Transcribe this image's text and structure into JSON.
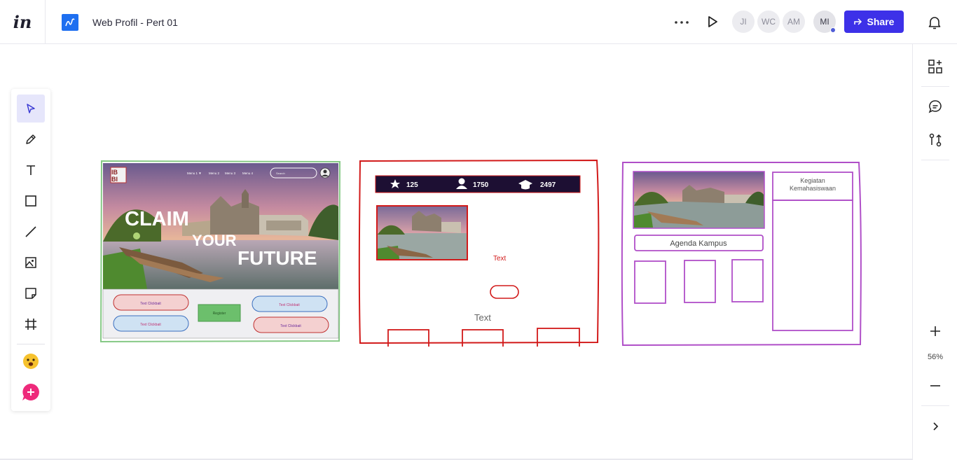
{
  "app": {
    "logo_text": "in"
  },
  "document": {
    "title": "Web Profil - Pert 01"
  },
  "header": {
    "collaborators": [
      "JI",
      "WC",
      "AM"
    ],
    "current_user": "MI",
    "share_label": "Share"
  },
  "zoom": {
    "level": "56%"
  },
  "left_tools": [
    "select",
    "pen",
    "text",
    "rectangle",
    "line",
    "image",
    "sticky-note",
    "frame",
    "emoji",
    "add"
  ],
  "frame1": {
    "logo_top": "IB",
    "logo_bottom": "BI",
    "nav": [
      "Menu 1 ▼",
      "Menu 2",
      "Menu 3",
      "Menu 4"
    ],
    "search_placeholder": "Search",
    "hero_line1": "CLAIM",
    "hero_line2": "YOUR",
    "hero_line3": "FUTURE",
    "buttons": [
      "Text Clickbait",
      "Text Clickbait",
      "Text Clickbait",
      "Text Clickbait"
    ],
    "register_label": "Register"
  },
  "frame2": {
    "stats": [
      "125",
      "1750",
      "2497"
    ],
    "red_text": "Text",
    "gray_text": "Text"
  },
  "frame3": {
    "agenda_label": "Agenda Kampus",
    "kegiatan_line1": "Kegiatan",
    "kegiatan_line2": "Kemahasiswaan"
  },
  "colors": {
    "share_bg": "#3d31e8",
    "frame1_border": "#7ec77e",
    "frame2_border": "#d21a1a",
    "frame3_border": "#b04fc8",
    "stats_bar_bg": "#1d0f33",
    "hero_sky": "#b98aa8"
  }
}
